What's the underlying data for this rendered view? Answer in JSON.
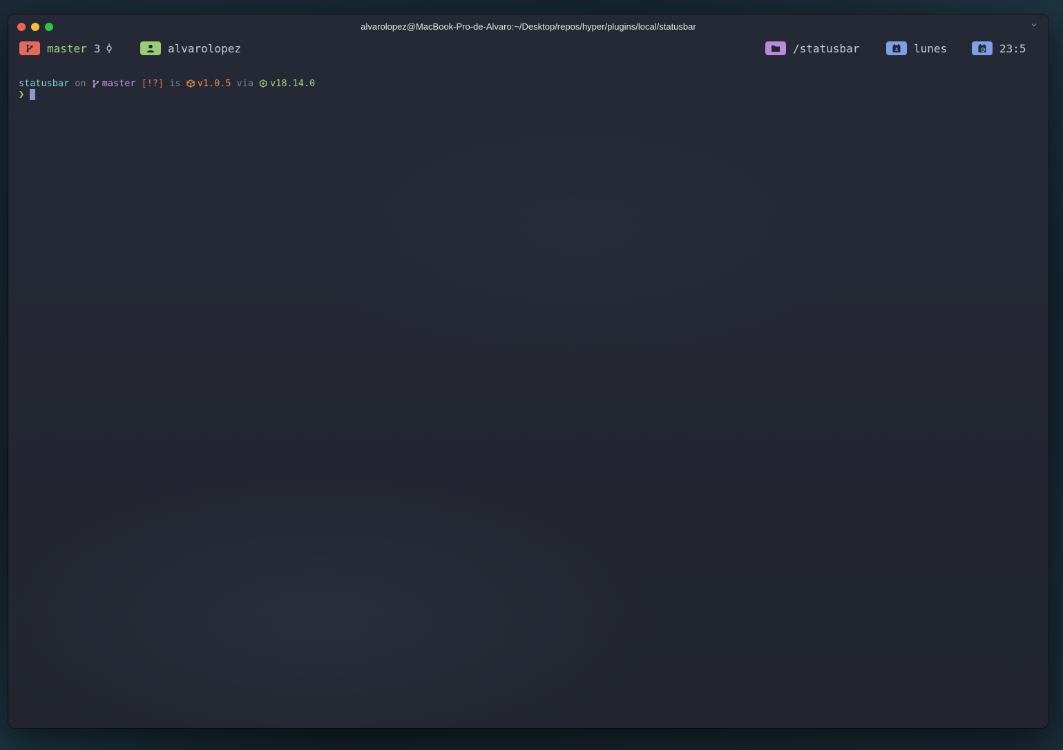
{
  "window": {
    "title": "alvarolopez@MacBook-Pro-de-Alvaro:~/Desktop/repos/hyper/plugins/local/statusbar"
  },
  "statusbar": {
    "git": {
      "icon": "git-branch-icon",
      "branch": "master",
      "count": "3",
      "count_icon": "git-commit-icon",
      "color": "#e46b5b"
    },
    "user": {
      "icon": "user-icon",
      "name": "alvarolopez",
      "color": "#9ccc74"
    },
    "cwd": {
      "icon": "folder-icon",
      "path": "/statusbar",
      "color": "#b98bdc"
    },
    "day": {
      "icon": "calendar-icon",
      "label": "lunes",
      "color": "#7da1e8"
    },
    "time": {
      "icon": "calendar-clock-icon",
      "label": "23:5",
      "color": "#7da1e8"
    }
  },
  "terminal": {
    "prompt": {
      "directory": "statusbar",
      "on": "on",
      "branch_icon": "git-branch-icon",
      "branch": "master",
      "git_status": "[!?]",
      "is": "is",
      "package_icon": "package-icon",
      "package_version": "v1.0.5",
      "via": "via",
      "node_icon": "nodejs-icon",
      "node_version": "v18.14.0",
      "symbol": "❯"
    }
  }
}
